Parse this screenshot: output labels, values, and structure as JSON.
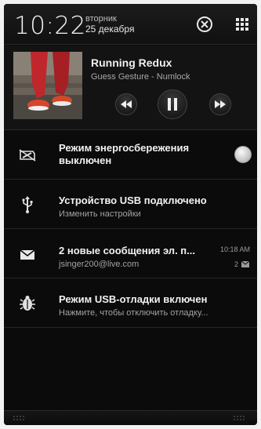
{
  "status": {
    "time": "10:22",
    "weekday": "вторник",
    "date": "25 декабря"
  },
  "header_icons": [
    "close-circle-icon",
    "grid-menu-icon"
  ],
  "music": {
    "title": "Running Redux",
    "artist": "Guess Gesture - Numlock",
    "controls": [
      "rewind-icon",
      "pause-icon",
      "fast-forward-icon"
    ]
  },
  "notifications": [
    {
      "icon": "battery-saver-icon",
      "title_line1": "Режим энергосбережения",
      "title_line2": "выключен"
    },
    {
      "icon": "usb-icon",
      "title": "Устройство USB подключено",
      "subtitle": "Изменить настройки"
    },
    {
      "icon": "mail-icon",
      "title": "2 новые сообщения эл. п...",
      "subtitle": "jsinger200@live.com",
      "time": "10:18 AM",
      "count": "2"
    },
    {
      "icon": "usb-debug-icon",
      "title": "Режим USB-отладки включен",
      "subtitle": "Нажмите, чтобы отключить отладку..."
    }
  ],
  "colors": {
    "background": "#0b0b0b",
    "text_primary": "#f2f2f2",
    "text_secondary": "#a3a3a3"
  }
}
